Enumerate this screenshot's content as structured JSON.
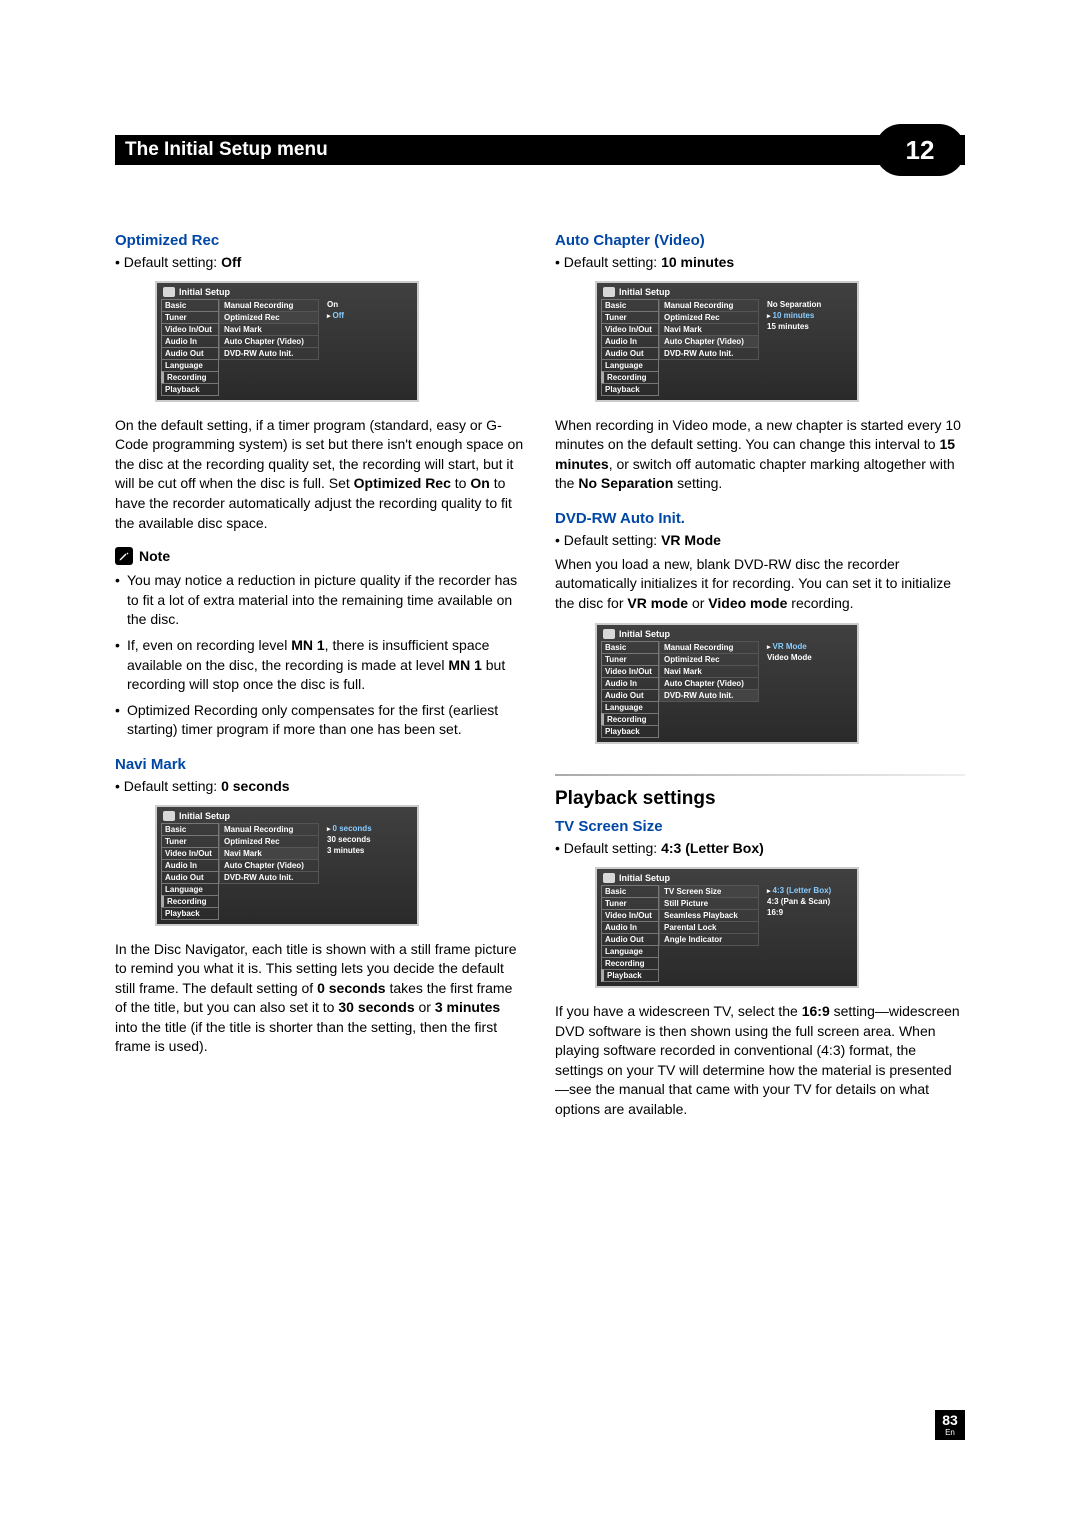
{
  "chapter": {
    "title": "The Initial Setup menu",
    "number": "12"
  },
  "page": {
    "number": "83",
    "lang": "En"
  },
  "sidebar": [
    "Basic",
    "Tuner",
    "Video In/Out",
    "Audio In",
    "Audio Out",
    "Language",
    "Recording",
    "Playback"
  ],
  "recording_items": [
    "Manual Recording",
    "Optimized Rec",
    "Navi Mark",
    "Auto Chapter (Video)",
    "DVD-RW Auto Init."
  ],
  "playback_items": [
    "TV Screen Size",
    "Still Picture",
    "Seamless Playback",
    "Parental Lock",
    "Angle Indicator"
  ],
  "panel_title": "Initial Setup",
  "left": {
    "optimized_rec": {
      "heading": "Optimized Rec",
      "default_prefix": "• Default setting: ",
      "default_value": "Off",
      "panel_values": [
        "On",
        "Off"
      ],
      "body": "On the default setting, if a timer program (standard, easy or G-Code programming system) is set but there isn't enough space on the disc at the recording quality set, the recording will start, but it will be cut off when the disc is full. Set ",
      "body_b1": "Optimized Rec",
      "body_mid1": " to ",
      "body_b2": "On",
      "body_tail": " to have the recorder automatically adjust the recording quality to fit the available disc space."
    },
    "note": {
      "label": "Note",
      "n1": "You may notice a reduction in picture quality if the recorder has to fit a lot of extra material into the remaining time available on the disc.",
      "n2_pre": "If, even on recording level ",
      "n2_b1": "MN 1",
      "n2_mid": ", there is insufficient space available on the disc, the recording is made at level ",
      "n2_b2": "MN 1",
      "n2_tail": " but recording will stop once the disc is full.",
      "n3": "Optimized Recording only compensates for the first (earliest starting) timer program if more than one has been set."
    },
    "navi_mark": {
      "heading": "Navi Mark",
      "default_prefix": "• Default setting: ",
      "default_value": "0 seconds",
      "panel_values": [
        "0 seconds",
        "30 seconds",
        "3 minutes"
      ],
      "body_pre": "In the Disc Navigator, each title is shown with a still frame picture to remind you what it is. This setting lets you decide the default still frame. The default setting of ",
      "body_b1": "0 seconds",
      "body_mid1": " takes the first frame of the title, but you can also set it to ",
      "body_b2": "30 seconds",
      "body_mid2": " or ",
      "body_b3": "3 minutes",
      "body_tail": " into the title (if the title is shorter than the setting, then the first frame is used)."
    }
  },
  "right": {
    "auto_chapter": {
      "heading": "Auto Chapter (Video)",
      "default_prefix": "• Default setting: ",
      "default_value": "10 minutes",
      "panel_values": [
        "No Separation",
        "10 minutes",
        "15 minutes"
      ],
      "body_pre": "When recording in Video mode, a new chapter is started every 10 minutes on the default setting. You can change this interval to ",
      "body_b1": "15 minutes",
      "body_mid": ", or switch off automatic chapter marking altogether with the ",
      "body_b2": "No Separation",
      "body_tail": " setting."
    },
    "dvdrw": {
      "heading": "DVD-RW Auto Init.",
      "default_prefix": "• Default setting: ",
      "default_value": "VR Mode",
      "panel_values": [
        "VR Mode",
        "Video Mode"
      ],
      "body_pre": "When you load a new, blank DVD-RW disc the recorder automatically initializes it for recording. You can set it to initialize the disc for ",
      "body_b1": "VR mode",
      "body_mid": " or ",
      "body_b2": "Video mode",
      "body_tail": " recording."
    },
    "playback_heading": "Playback settings",
    "tv_screen": {
      "heading": "TV Screen Size",
      "default_prefix": "• Default setting: ",
      "default_value": "4:3 (Letter Box)",
      "panel_values": [
        "4:3 (Letter Box)",
        "4:3 (Pan & Scan)",
        "16:9"
      ],
      "body_pre": "If you have a widescreen TV, select the ",
      "body_b1": "16:9",
      "body_tail": " setting—widescreen DVD software is then shown using the full screen area. When playing software recorded in conventional (4:3) format, the settings on your TV will determine how the material is presented—see the manual that came with your TV for details on what options are available."
    }
  }
}
